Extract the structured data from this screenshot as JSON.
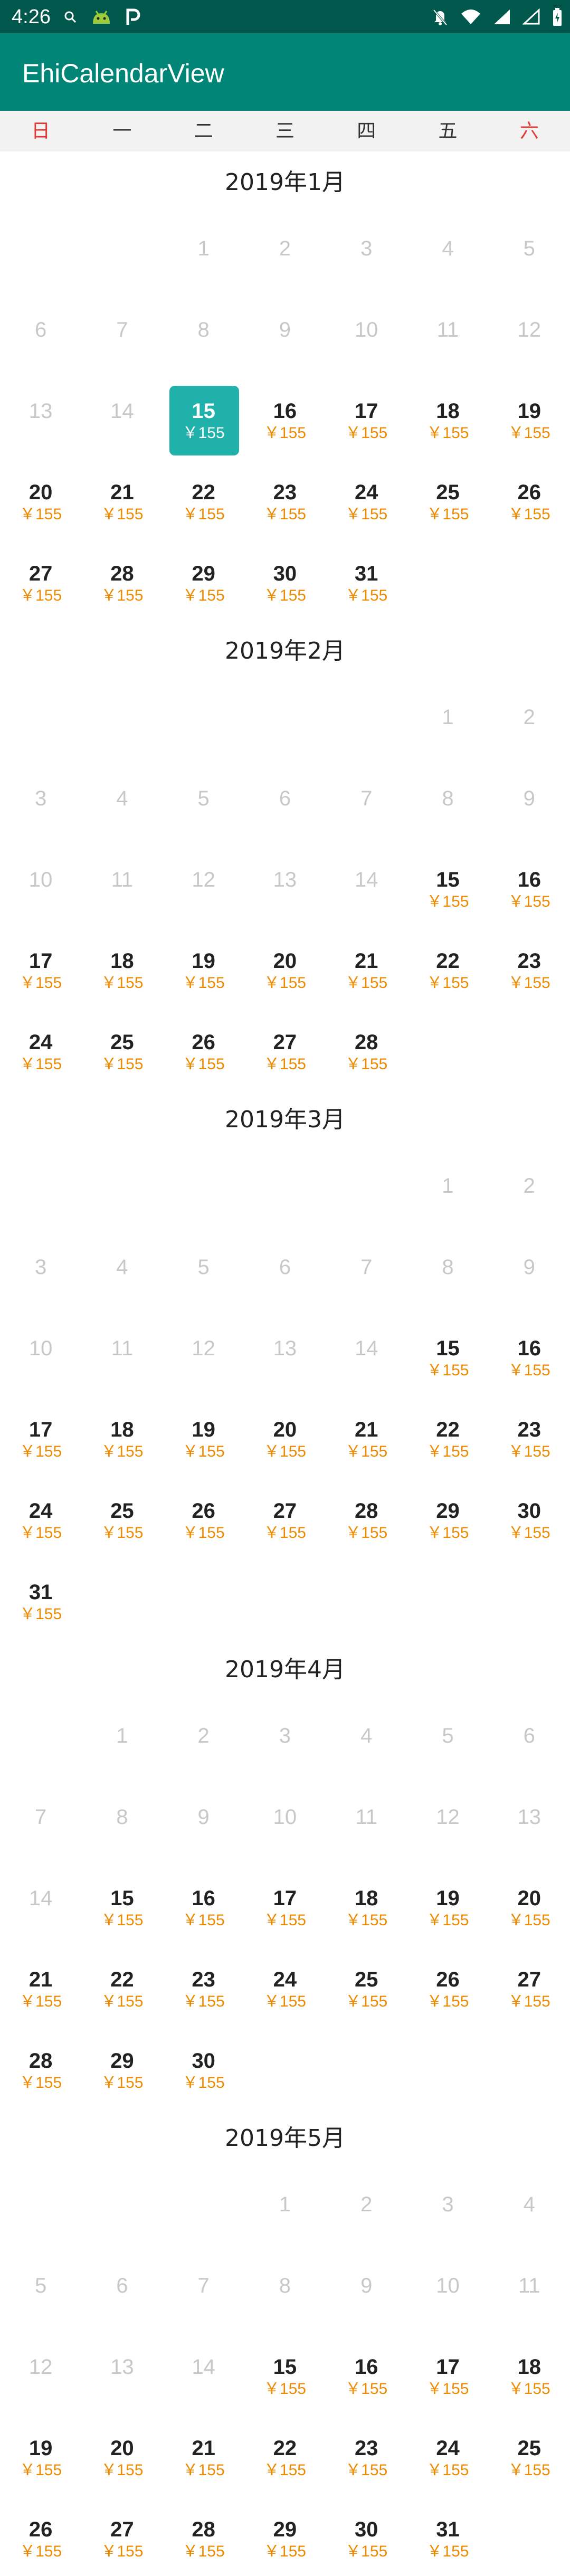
{
  "status_bar": {
    "time": "4:26"
  },
  "app_bar": {
    "title": "EhiCalendarView"
  },
  "weekdays": [
    "日",
    "一",
    "二",
    "三",
    "四",
    "五",
    "六"
  ],
  "price_label": "￥155",
  "colors": {
    "status_bar": "#00574b",
    "app_bar": "#008577",
    "selected": "#20b2aa",
    "price": "#f08a00",
    "weekend": "#e53935"
  },
  "months": [
    {
      "title": "2019年1月",
      "lead_blanks": 2,
      "days": 31,
      "first_available": 15,
      "selected": 15
    },
    {
      "title": "2019年2月",
      "lead_blanks": 5,
      "days": 28,
      "first_available": 15,
      "selected": null
    },
    {
      "title": "2019年3月",
      "lead_blanks": 5,
      "days": 31,
      "first_available": 15,
      "selected": null
    },
    {
      "title": "2019年4月",
      "lead_blanks": 1,
      "days": 30,
      "first_available": 15,
      "selected": null
    },
    {
      "title": "2019年5月",
      "lead_blanks": 3,
      "days": 31,
      "first_available": 15,
      "selected": null
    }
  ]
}
